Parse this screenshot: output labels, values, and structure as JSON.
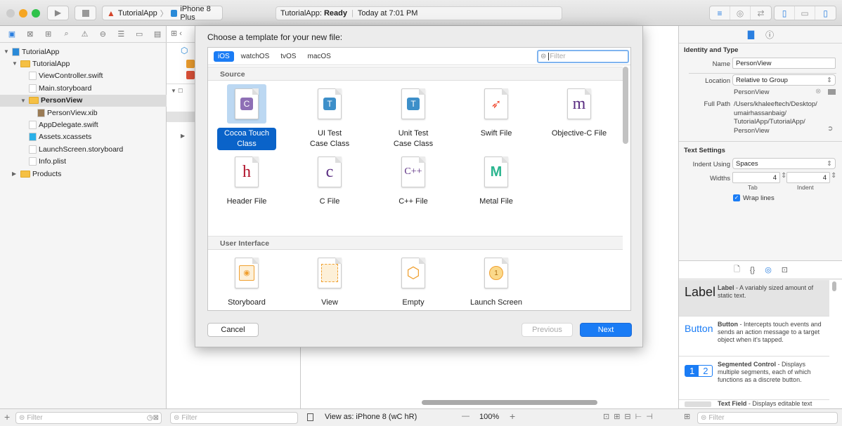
{
  "toolbar": {
    "scheme_app": "TutorialApp",
    "scheme_device": "iPhone 8 Plus",
    "activity_app": "TutorialApp:",
    "activity_status": "Ready",
    "activity_time": "Today at 7:01 PM"
  },
  "navigator": {
    "items": [
      {
        "label": "TutorialApp",
        "type": "project",
        "level": 0,
        "open": true
      },
      {
        "label": "TutorialApp",
        "type": "folder",
        "level": 1,
        "open": true
      },
      {
        "label": "ViewController.swift",
        "type": "swift",
        "level": 2
      },
      {
        "label": "Main.storyboard",
        "type": "storyboard",
        "level": 2
      },
      {
        "label": "PersonView",
        "type": "folder",
        "level": 2,
        "open": true,
        "selected": true
      },
      {
        "label": "PersonView.xib",
        "type": "xib",
        "level": 3
      },
      {
        "label": "AppDelegate.swift",
        "type": "swift",
        "level": 2
      },
      {
        "label": "Assets.xcassets",
        "type": "assets",
        "level": 2
      },
      {
        "label": "LaunchScreen.storyboard",
        "type": "storyboard",
        "level": 2
      },
      {
        "label": "Info.plist",
        "type": "plist",
        "level": 2
      },
      {
        "label": "Products",
        "type": "folder",
        "level": 1,
        "open": false
      }
    ],
    "filter_placeholder": "Filter"
  },
  "outline": {
    "filter_placeholder": "Filter"
  },
  "dialog": {
    "title": "Choose a template for your new file:",
    "platforms": [
      "iOS",
      "watchOS",
      "tvOS",
      "macOS"
    ],
    "selected_platform": "iOS",
    "filter_placeholder": "Filter",
    "sections": [
      {
        "title": "Source",
        "items": [
          {
            "name": "Cocoa Touch\nClass",
            "icon": "C",
            "color": "#8e6fb5",
            "selected": true
          },
          {
            "name": "UI Test\nCase Class",
            "icon": "T",
            "color": "#3d8fc9"
          },
          {
            "name": "Unit Test\nCase Class",
            "icon": "T",
            "color": "#3d8fc9"
          },
          {
            "name": "Swift File",
            "icon": "swift",
            "color": "#f05138"
          },
          {
            "name": "Objective-C File",
            "icon": "m",
            "color": "#5a2d82"
          },
          {
            "name": "Header File",
            "icon": "h",
            "color": "#b0122a"
          },
          {
            "name": "C File",
            "icon": "c",
            "color": "#5a2d82"
          },
          {
            "name": "C++ File",
            "icon": "C++",
            "color": "#5a2d82"
          },
          {
            "name": "Metal File",
            "icon": "M",
            "color": "#2bb58f"
          }
        ]
      },
      {
        "title": "User Interface",
        "items": [
          {
            "name": "Storyboard",
            "icon": "storyboard",
            "color": "#f0a030"
          },
          {
            "name": "View",
            "icon": "view",
            "color": "#f0a030"
          },
          {
            "name": "Empty",
            "icon": "cube",
            "color": "#f0a030"
          },
          {
            "name": "Launch Screen",
            "icon": "1",
            "color": "#f0a030"
          }
        ]
      }
    ],
    "cancel": "Cancel",
    "previous": "Previous",
    "next": "Next"
  },
  "inspector": {
    "identity_title": "Identity and Type",
    "name_label": "Name",
    "name_value": "PersonView",
    "location_label": "Location",
    "location_value": "Relative to Group",
    "location_file": "PersonView",
    "fullpath_label": "Full Path",
    "fullpath_lines": [
      "/Users/khaleeftech/Desktop/",
      "umairhassanbaig/",
      "TutorialApp/TutorialApp/",
      "PersonView"
    ],
    "text_settings_title": "Text Settings",
    "indent_label": "Indent Using",
    "indent_value": "Spaces",
    "widths_label": "Widths",
    "tab_value": "4",
    "indent_width_value": "4",
    "tab_caption": "Tab",
    "indent_caption": "Indent",
    "wrap_label": "Wrap lines",
    "wrap_checked": true
  },
  "library": {
    "items": [
      {
        "preview": "Label",
        "title": "Label",
        "desc": " - A variably sized amount of static text."
      },
      {
        "preview": "Button",
        "title": "Button",
        "desc": " - Intercepts touch events and sends an action message to a target object when it's tapped."
      },
      {
        "preview": "12",
        "title": "Segmented Control",
        "desc": " - Displays multiple segments, each of which functions as a discrete button."
      },
      {
        "preview": "",
        "title": "Text Field",
        "desc": " - Displays editable text"
      }
    ],
    "filter_placeholder": "Filter"
  },
  "bottom": {
    "view_as": "View as: iPhone 8 (wC hR)",
    "zoom": "100%",
    "minus": "—",
    "plus": "+"
  },
  "colors": {
    "accent": "#1a7cf5",
    "selection": "#0a63c9"
  }
}
